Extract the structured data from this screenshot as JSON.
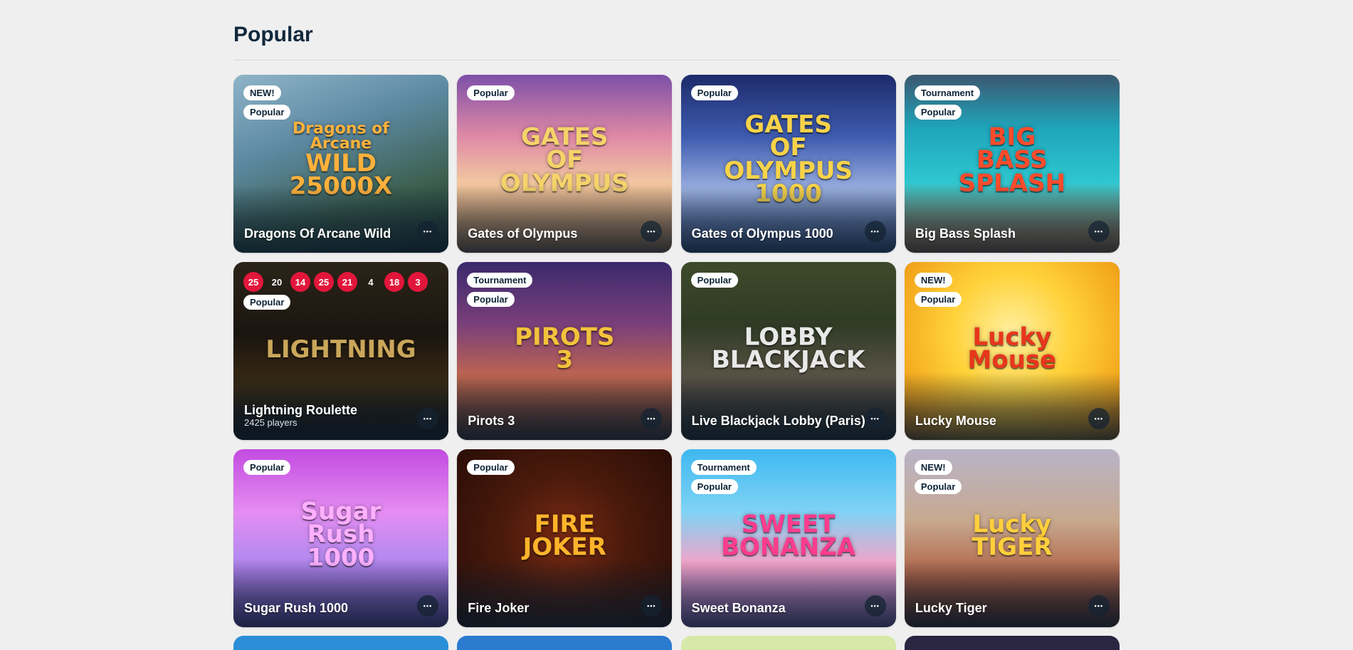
{
  "section": {
    "title": "Popular"
  },
  "more_glyph": "•••",
  "tiles": [
    {
      "name": "Dragons Of Arcane Wild",
      "badges": [
        "NEW!",
        "Popular"
      ],
      "logo": [
        "Dragons of Arcane",
        "WILD",
        "25000X"
      ],
      "bg": "linear-gradient(160deg,#8fb4c8 0%,#5d8aa3 35%,#3c5f4e 70%,#203a33 100%)",
      "logo_color": "#ffb13b"
    },
    {
      "name": "Gates of Olympus",
      "badges": [
        "Popular"
      ],
      "logo": [
        "GATES OF",
        "OLYMPUS"
      ],
      "bg": "linear-gradient(180deg,#7d4fa8 0%,#e08aa6 35%,#f1c6a0 60%,#c98d57 100%)",
      "logo_color": "#f5d36a"
    },
    {
      "name": "Gates of Olympus 1000",
      "badges": [
        "Popular"
      ],
      "logo": [
        "GATES OF",
        "OLYMPUS",
        "1000"
      ],
      "bg": "linear-gradient(180deg,#1d2a6a 0%,#3e5cb0 35%,#9bb0e0 65%,#4f6ba8 100%)",
      "logo_color": "#f7d34a"
    },
    {
      "name": "Big Bass Splash",
      "badges": [
        "Tournament",
        "Popular"
      ],
      "logo": [
        "BIG BASS",
        "SPLASH"
      ],
      "bg": "linear-gradient(180deg,#3b5770 0%,#1fa5ba 30%,#2ec6d0 60%,#d9864c 100%)",
      "logo_color": "#ff4b2b"
    },
    {
      "name": "Lightning Roulette",
      "sub": "2425 players",
      "badges": [
        "Popular"
      ],
      "results": [
        {
          "v": "25",
          "c": "red"
        },
        {
          "v": "20",
          "c": "black"
        },
        {
          "v": "14",
          "c": "red"
        },
        {
          "v": "25",
          "c": "red"
        },
        {
          "v": "21",
          "c": "red"
        },
        {
          "v": "4",
          "c": "black"
        },
        {
          "v": "18",
          "c": "red"
        },
        {
          "v": "3",
          "c": "red"
        }
      ],
      "logo": [
        "LIGHTNING"
      ],
      "bg": "linear-gradient(180deg,#2b2418 0%,#1a1510 40%,#3a2a12 70%,#120f0b 100%)",
      "logo_color": "#c9a65a"
    },
    {
      "name": "Pirots 3",
      "badges": [
        "Tournament",
        "Popular"
      ],
      "logo": [
        "PIROTS",
        "3"
      ],
      "bg": "linear-gradient(180deg,#3b2a6d 0%,#7a3f7a 35%,#c0664f 65%,#5a3b2e 100%)",
      "logo_color": "#f2c23b"
    },
    {
      "name": "Live Blackjack Lobby (Paris)",
      "badges": [
        "Popular"
      ],
      "logo": [
        "LOBBY",
        "BLACKJACK"
      ],
      "bg": "linear-gradient(180deg,#3d4a2a 0%,#2f3b25 35%,#5b5446 65%,#2c2a25 100%)",
      "logo_color": "#e8e8e8"
    },
    {
      "name": "Lucky Mouse",
      "badges": [
        "NEW!",
        "Popular"
      ],
      "logo": [
        "Lucky",
        "Mouse"
      ],
      "bg": "radial-gradient(circle at 50% 40%,#fff0a0 0%,#ffd23a 40%,#f2a41a 80%,#c9770f 100%)",
      "logo_color": "#e8361c"
    },
    {
      "name": "Sugar Rush 1000",
      "badges": [
        "Popular"
      ],
      "logo": [
        "Sugar Rush",
        "1000"
      ],
      "bg": "linear-gradient(180deg,#c24be0 0%,#e58cf2 35%,#b78af0 60%,#7f5bd0 100%)",
      "logo_color": "#ffb0ff"
    },
    {
      "name": "Fire Joker",
      "badges": [
        "Popular"
      ],
      "logo": [
        "FIRE JOKER"
      ],
      "bg": "radial-gradient(circle at 50% 50%,#7a2a12 0%,#4a1a0c 45%,#2a0d06 100%)",
      "logo_color": "#ffb42b"
    },
    {
      "name": "Sweet Bonanza",
      "badges": [
        "Tournament",
        "Popular"
      ],
      "logo": [
        "SWEET",
        "BONANZA"
      ],
      "bg": "linear-gradient(180deg,#3eb8f0 0%,#7fd3f5 35%,#f5a3c8 65%,#a277d6 100%)",
      "logo_color": "#ff3c8e"
    },
    {
      "name": "Lucky Tiger",
      "badges": [
        "NEW!",
        "Popular"
      ],
      "logo": [
        "Lucky",
        "TIGER"
      ],
      "bg": "linear-gradient(180deg,#b9b3c8 0%,#c7a98f 40%,#b0664a 70%,#5a2a1f 100%)",
      "logo_color": "#ffcf3b"
    }
  ],
  "peek_colors": [
    "#2a8fd6",
    "#2a7ad0",
    "#d7e9a8",
    "#2a2540"
  ]
}
